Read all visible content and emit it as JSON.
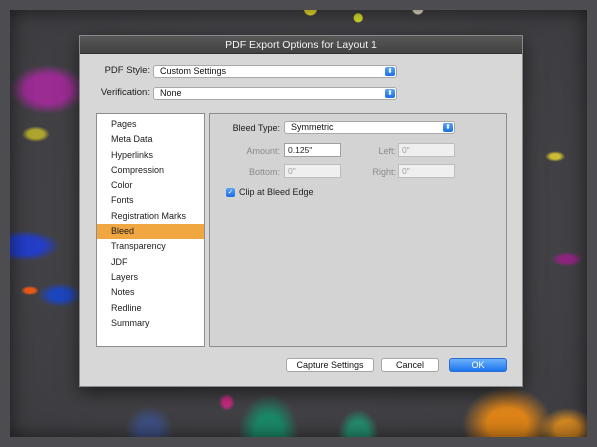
{
  "window": {
    "title": "PDF Export Options for Layout 1"
  },
  "pdf_style": {
    "label": "PDF Style:",
    "value": "Custom Settings"
  },
  "verification": {
    "label": "Verification:",
    "value": "None"
  },
  "sidebar": {
    "items": [
      {
        "label": "Pages"
      },
      {
        "label": "Meta Data"
      },
      {
        "label": "Hyperlinks"
      },
      {
        "label": "Compression"
      },
      {
        "label": "Color"
      },
      {
        "label": "Fonts"
      },
      {
        "label": "Registration Marks"
      },
      {
        "label": "Bleed"
      },
      {
        "label": "Transparency"
      },
      {
        "label": "JDF"
      },
      {
        "label": "Layers"
      },
      {
        "label": "Notes"
      },
      {
        "label": "Redline"
      },
      {
        "label": "Summary"
      }
    ],
    "selected": "Bleed"
  },
  "bleed": {
    "type_label": "Bleed Type:",
    "type_value": "Symmetric",
    "amount_label": "Amount:",
    "amount_value": "0.125\"",
    "left_label": "Left:",
    "left_value": "0\"",
    "bottom_label": "Bottom:",
    "bottom_value": "0\"",
    "right_label": "Right:",
    "right_value": "0\"",
    "clip_label": "Clip at Bleed Edge",
    "clip_checked": true
  },
  "buttons": {
    "capture": "Capture Settings",
    "cancel": "Cancel",
    "ok": "OK"
  },
  "colors": {
    "accent": "#1c74ee",
    "selection": "#f0a741"
  }
}
